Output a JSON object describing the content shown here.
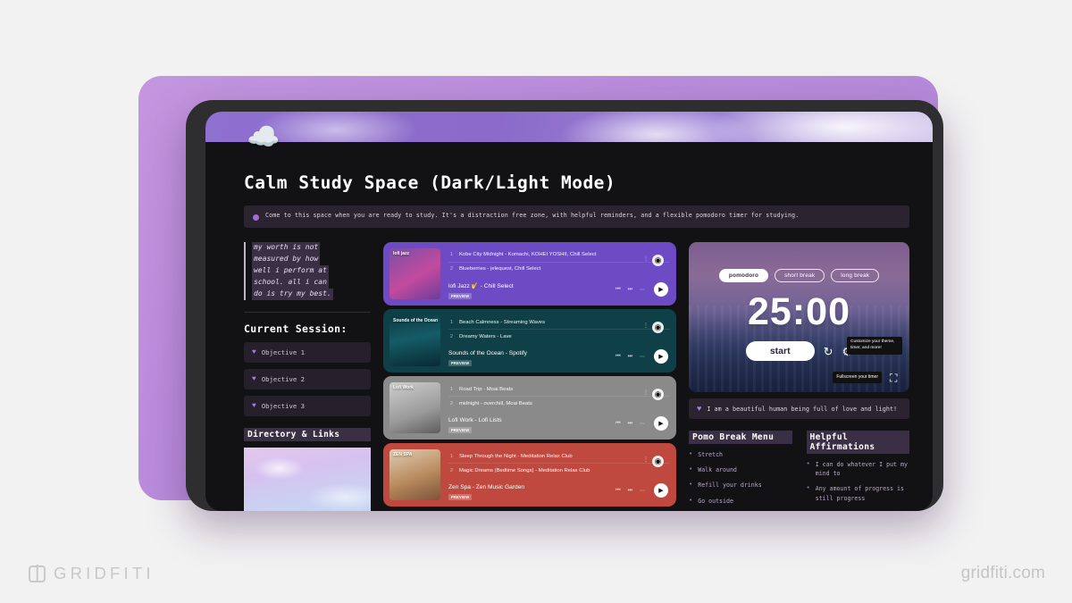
{
  "branding": {
    "logo_text": "GRIDFITI",
    "watermark": "gridfiti.com"
  },
  "page": {
    "banner_icon": "cloud-icon",
    "title": "Calm Study Space (Dark/Light Mode)",
    "callout": "Come to this space when you are ready to study. It's a distraction free zone, with helpful reminders, and a flexible pomodoro timer for studying."
  },
  "sidebar": {
    "quote_lines": [
      "my worth is not",
      "measured by how",
      "well i perform at",
      "school. all i can",
      "do is try my best."
    ],
    "session_title": "Current Session:",
    "objectives": [
      {
        "icon": "heart-icon",
        "label": "Objective 1"
      },
      {
        "icon": "heart-icon",
        "label": "Objective 2"
      },
      {
        "icon": "heart-icon",
        "label": "Objective 3"
      }
    ],
    "directory_title": "Directory & Links"
  },
  "playlists": [
    {
      "accent": "#6c4bc4",
      "art_class": "art-lofi",
      "art_label": "lofi jazz",
      "name": "lofi Jazz 🎷 - Chill Select",
      "preview": "PREVIEW",
      "tracks": [
        {
          "n": "1",
          "title": "Kobe City Midnight - Komachi, KOHEI YOSHII, Chill Select"
        },
        {
          "n": "2",
          "title": "Blueberries - jelequest, Chill Select"
        }
      ]
    },
    {
      "accent": "#0f3f47",
      "art_class": "art-ocean",
      "art_label": "Sounds\nof the Ocean",
      "name": "Sounds of the Ocean - Spotify",
      "preview": "PREVIEW",
      "tracks": [
        {
          "n": "1",
          "title": "Beach Calmness - Streaming Waves"
        },
        {
          "n": "2",
          "title": "Dreamy Waters - Lave"
        }
      ]
    },
    {
      "accent": "#8a8a8a",
      "art_class": "art-work",
      "art_label": "Lofi Work",
      "name": "Lofi Work - Lofi Lists",
      "preview": "PREVIEW",
      "tracks": [
        {
          "n": "1",
          "title": "Road Trip - Moai Beats"
        },
        {
          "n": "2",
          "title": "midnight - overchill, Moai Beats"
        }
      ]
    },
    {
      "accent": "#c0493f",
      "art_class": "art-zen",
      "art_label": "ZEN\nSPA",
      "name": "Zen Spa - Zen Music Garden",
      "preview": "PREVIEW",
      "tracks": [
        {
          "n": "1",
          "title": "Sleep Through the Night - Meditation Relax Club"
        },
        {
          "n": "2",
          "title": "Magic Dreams (Bedtime Songs) - Meditation Relax Club"
        }
      ]
    }
  ],
  "pomodoro": {
    "tabs": [
      {
        "label": "pomodoro",
        "active": true
      },
      {
        "label": "short break",
        "active": false
      },
      {
        "label": "long break",
        "active": false
      }
    ],
    "time": "25:00",
    "start_label": "start",
    "reset_icon": "reset-icon",
    "settings_icon": "gear-icon",
    "fullscreen_icon": "fullscreen-icon",
    "tooltip_settings": "Customize your theme, timer, and more!",
    "tooltip_fullscreen": "Fullscreen your timer"
  },
  "affirmation_bar": {
    "icon": "heart-icon",
    "text": "I am a beautiful human being full of love and light!"
  },
  "break_menu": {
    "title": "Pomo Break Menu",
    "items": [
      "Stretch",
      "Walk around",
      "Refill your drinks",
      "Go outside"
    ]
  },
  "affirmations": {
    "title": "Helpful Affirmations",
    "items": [
      "I can do whatever I put my mind to",
      "Any amount of progress is still progress"
    ]
  }
}
